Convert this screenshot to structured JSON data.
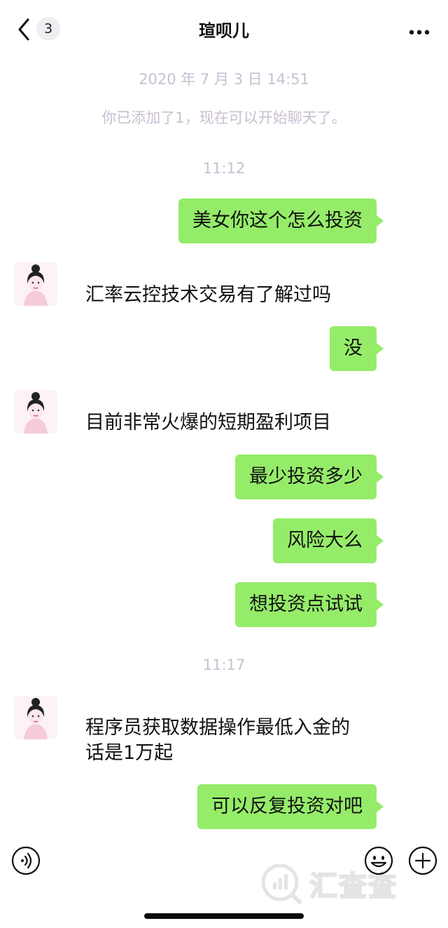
{
  "header": {
    "title": "瑄呗儿",
    "unread_count": "3"
  },
  "chat": {
    "time_added": "2020 年 7 月 3 日 14:51",
    "added_note": "你已添加了1，现在可以开始聊天了。",
    "time_1": "11:12",
    "time_2": "11:17",
    "messages": [
      {
        "side": "right",
        "text": "美女你这个怎么投资"
      },
      {
        "side": "left",
        "text": "汇率云控技术交易有了解过吗"
      },
      {
        "side": "right",
        "text": "没"
      },
      {
        "side": "left",
        "text": "目前非常火爆的短期盈利项目"
      },
      {
        "side": "right",
        "text": "最少投资多少"
      },
      {
        "side": "right",
        "text": "风险大么"
      },
      {
        "side": "right",
        "text": "想投资点试试"
      },
      {
        "side": "left",
        "text": "程序员获取数据操作最低入金的话是1万起"
      },
      {
        "side": "right",
        "text": "可以反复投资对吧"
      }
    ]
  },
  "bottom": {
    "watermark": "汇查查"
  },
  "icons": {
    "back": "chevron-left-icon",
    "more": "more-dots-icon",
    "voice": "voice-icon",
    "emoji": "emoji-icon",
    "plus": "plus-icon"
  },
  "colors": {
    "outgoing_bubble": "#95ec69",
    "system_text": "#c9bfd1"
  }
}
